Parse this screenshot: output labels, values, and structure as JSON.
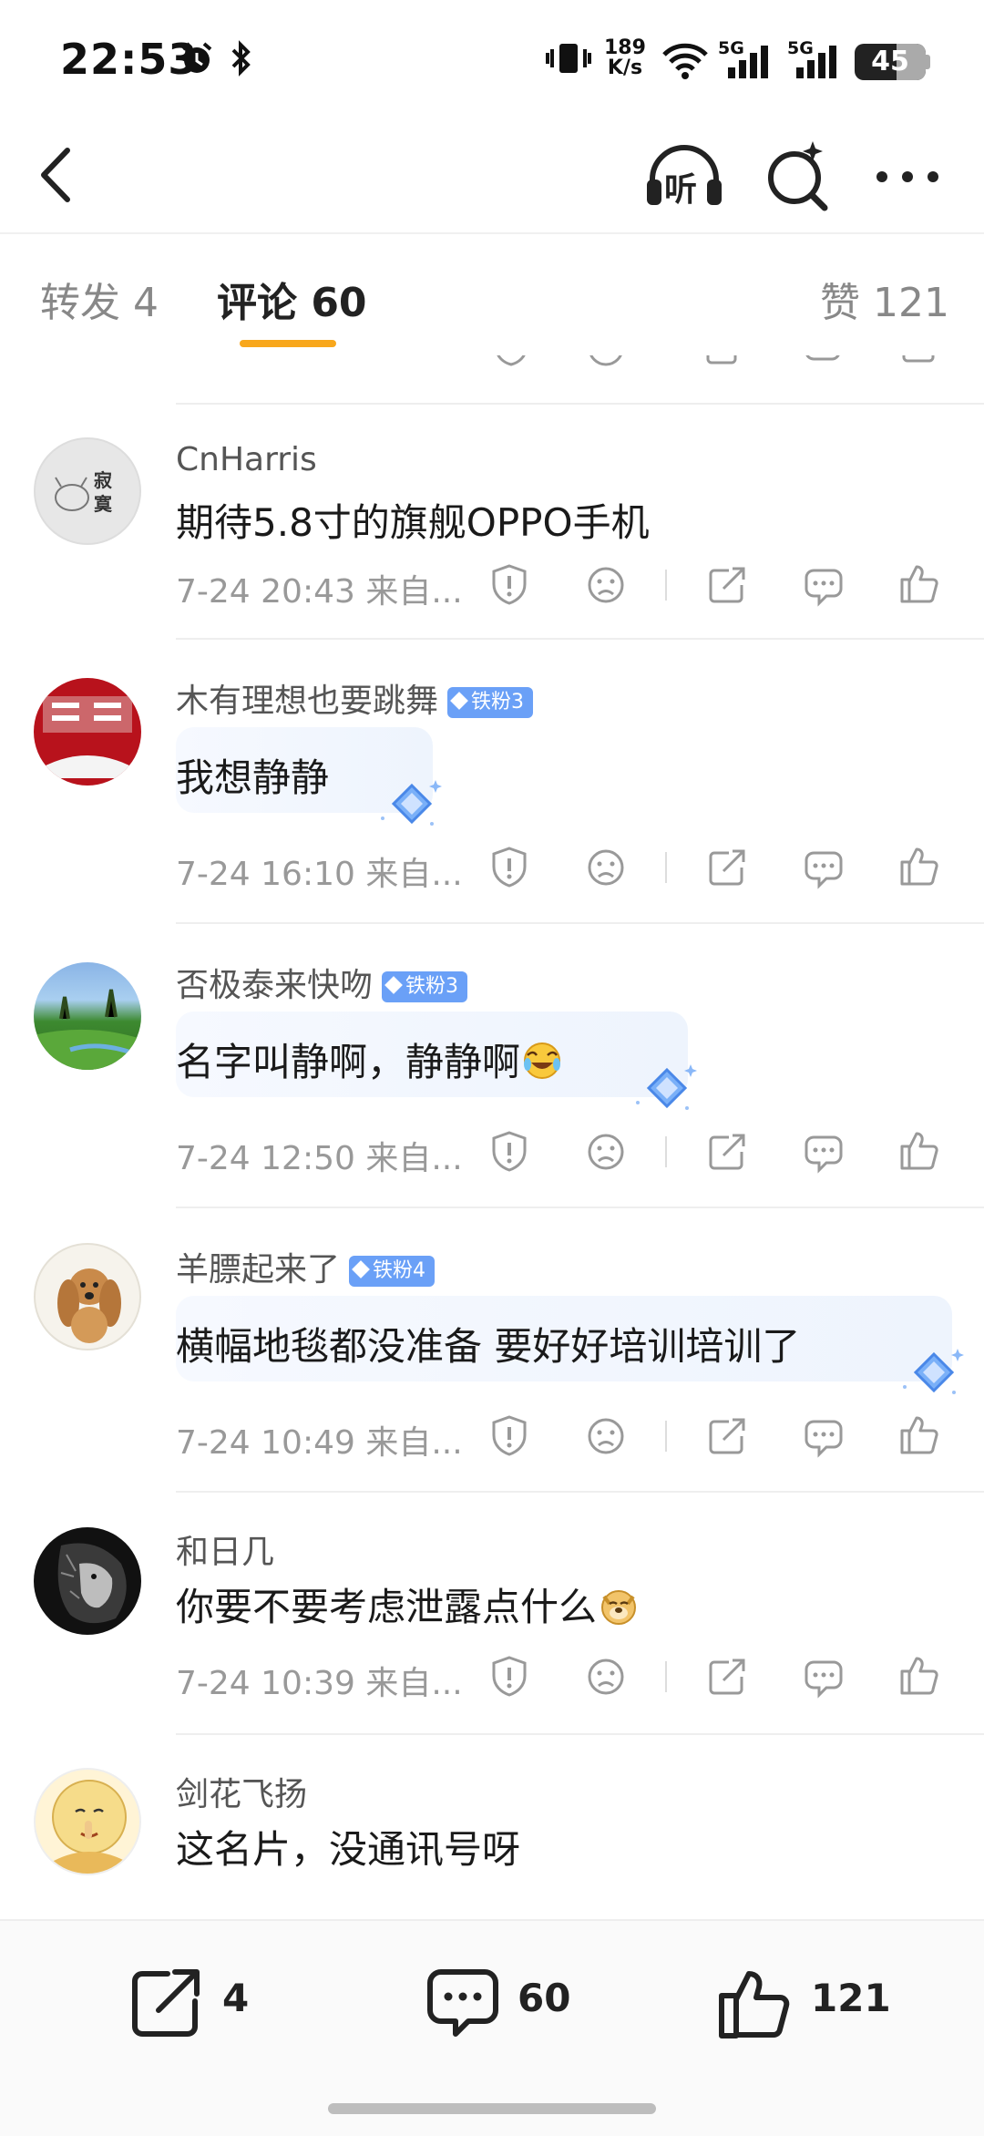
{
  "status_bar": {
    "time": "22:53",
    "net_speed_value": "189",
    "net_speed_unit": "K/s",
    "signal_1": "5G",
    "signal_2": "5G",
    "battery": "45",
    "icons": [
      "alarm-icon",
      "bluetooth-icon",
      "vibrate-icon",
      "wifi-icon",
      "signal-icon",
      "battery-icon"
    ]
  },
  "header": {
    "icons": [
      "back-icon",
      "listen-icon",
      "search-icon",
      "more-icon"
    ],
    "listen_label": "听"
  },
  "tabs": [
    {
      "label": "转发 4"
    },
    {
      "label": "评论 60"
    },
    {
      "label": "赞 121"
    }
  ],
  "comments": [
    {
      "username": "CnHarris",
      "badge": "",
      "text": "期待5.8寸的旗舰OPPO手机",
      "meta": "7-24 20:43  来自...",
      "avatar_text": "寂寞"
    },
    {
      "username": "木有理想也要跳舞",
      "badge": "铁粉3",
      "text": "我想静静",
      "meta": "7-24 16:10  来自..."
    },
    {
      "username": "否极泰来快吻",
      "badge": "铁粉3",
      "text": "名字叫静啊，静静啊",
      "meta": "7-24 12:50  来自..."
    },
    {
      "username": "羊膘起来了",
      "badge": "铁粉4",
      "text": "横幅地毯都没准备 要好好培训培训了",
      "meta": "7-24 10:49  来自..."
    },
    {
      "username": "和日几",
      "badge": "",
      "text": "你要不要考虑泄露点什么",
      "meta": "7-24 10:39  来自..."
    },
    {
      "username": "剑花飞扬",
      "badge": "",
      "text": "这名片，没通讯号呀",
      "meta": ""
    }
  ],
  "bottom_bar": {
    "repost_count": "4",
    "comment_count": "60",
    "like_count": "121"
  },
  "colors": {
    "accent": "#f8a71c",
    "badge": "#6aa0f7",
    "meta": "#999999"
  }
}
